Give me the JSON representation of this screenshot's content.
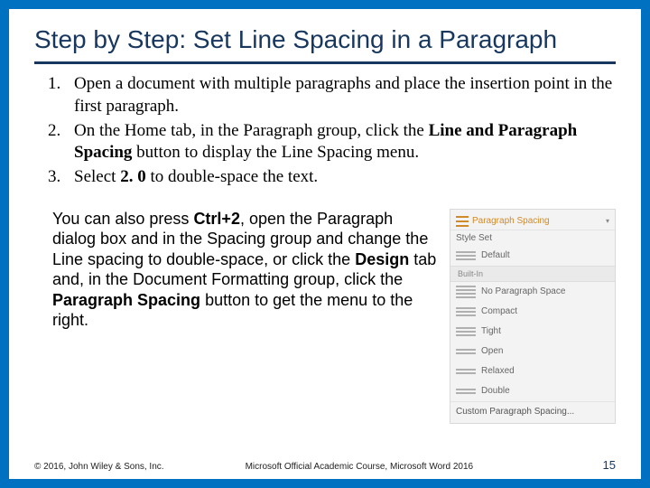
{
  "title": "Step by Step: Set Line Spacing in a Paragraph",
  "steps": {
    "s1": "Open a document with multiple paragraphs and place the insertion point in the first paragraph.",
    "s2a": "On the Home tab, in the Paragraph group, click the ",
    "s2b": "Line and Paragraph Spacing",
    "s2c": " button to display the Line Spacing menu.",
    "s3a": "Select ",
    "s3b": "2. 0",
    "s3c": " to double-space the text."
  },
  "note": {
    "t1": "You can also press ",
    "t2": "Ctrl+2",
    "t3": ", open the Paragraph dialog box and in the Spacing group and change the Line spacing to double-space, or click the ",
    "t4": "Design",
    "t5": " tab and, in the Document Formatting group, click the ",
    "t6": "Paragraph Spacing",
    "t7": " button to get the menu to the right."
  },
  "menu": {
    "top": "Paragraph Spacing",
    "styleset": "Style Set",
    "default": "Default",
    "section": "Built-In",
    "items": {
      "i0": "No Paragraph Space",
      "i1": "Compact",
      "i2": "Tight",
      "i3": "Open",
      "i4": "Relaxed",
      "i5": "Double"
    },
    "custom": "Custom Paragraph Spacing..."
  },
  "footer": {
    "left": "© 2016, John Wiley & Sons, Inc.",
    "mid": "Microsoft Official Academic Course, Microsoft Word 2016",
    "page": "15"
  }
}
